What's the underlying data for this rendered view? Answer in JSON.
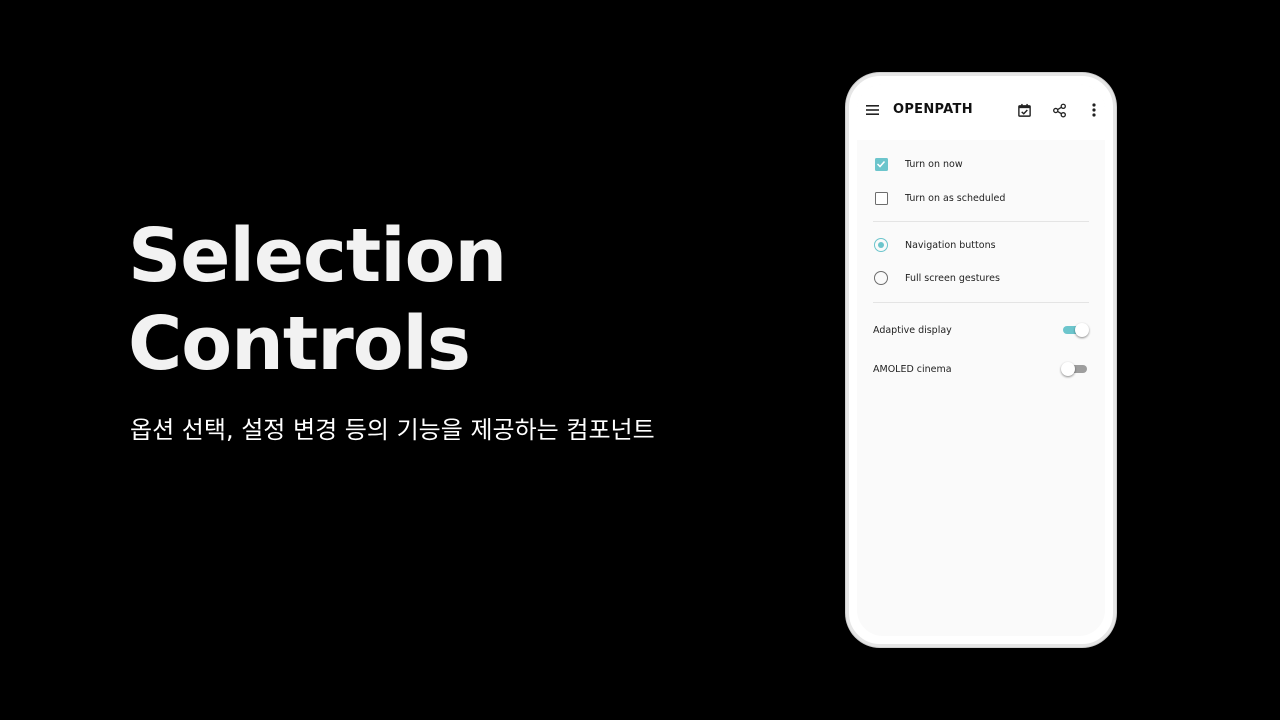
{
  "hero": {
    "title_line1": "Selection",
    "title_line2": "Controls",
    "subtitle": "옵션 선택, 설정 변경 등의 기능을 제공하는 컴포넌트"
  },
  "app": {
    "title": "OPENPATH",
    "icons": [
      "menu-icon",
      "calendar-check-icon",
      "share-icon",
      "more-vert-icon"
    ]
  },
  "checkboxes": [
    {
      "label": "Turn on now",
      "checked": true
    },
    {
      "label": "Turn on as scheduled",
      "checked": false
    }
  ],
  "radios": [
    {
      "label": "Navigation buttons",
      "selected": true
    },
    {
      "label": "Full screen gestures",
      "selected": false
    }
  ],
  "switches": [
    {
      "label": "Adaptive display",
      "on": true
    },
    {
      "label": "AMOLED cinema",
      "on": false
    }
  ],
  "colors": {
    "background": "#000000",
    "accent": "#6cc5cc",
    "screen": "#fafafa",
    "text": "#222222"
  }
}
